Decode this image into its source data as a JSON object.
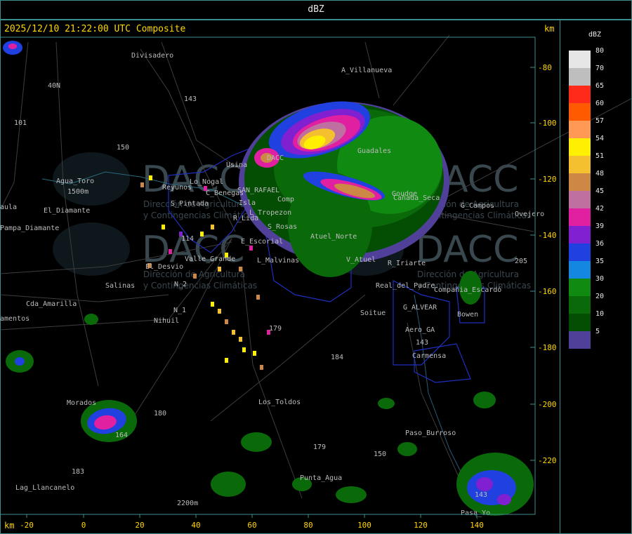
{
  "header": {
    "title": "dBZ"
  },
  "map": {
    "timestamp": "2025/12/10 21:22:00 UTC Composite",
    "km_label_top": "km",
    "km_label_bottom": "km",
    "x_ticks": [
      "-20",
      "0",
      "20",
      "40",
      "60",
      "80",
      "100",
      "120",
      "140"
    ],
    "y_ticks": [
      "-80",
      "-100",
      "-120",
      "-140",
      "-160",
      "-180",
      "-200",
      "-220"
    ],
    "places": [
      "Divisadero",
      "A_Villanueva",
      "40N",
      "143",
      "101",
      "150",
      "Usina",
      "Guadales",
      "DACC",
      "Agua_Toro",
      "1500m",
      "El_Diamante",
      "aula",
      "Reyunos",
      "Lo_Nogal",
      "C_Benegas",
      "SAN_RAFAEL",
      "Goudge",
      "Cañada_Seca",
      "G_Campos",
      "Ovejero",
      "Pampa_Diamante",
      "S_Pintada",
      "R_Lida",
      "L_Tropezon",
      "Isla",
      "Comp",
      "S_Rosas",
      "Atuel_Norte",
      "114",
      "E_Escorial",
      "205",
      "Valle_Grande",
      "L_Malvinas",
      "V_Atuel",
      "R_Iriarte",
      "El_Desvio",
      "Salinas",
      "Real_del_Padre",
      "Compañia_Escardó",
      "N_2",
      "N_1",
      "Cda_Amarilla",
      "amentos",
      "Nihuil",
      "Soitue",
      "G_ALVEAR",
      "Bowen",
      "179",
      "Aero_GA",
      "143",
      "Carmensa",
      "184",
      "Morados",
      "Los_Toldos",
      "180",
      "Paso_Burroso",
      "164",
      "179",
      "150",
      "183",
      "Punta_Agua",
      "Lag_Llancanelo",
      "2200m",
      "143",
      "Pasa_Yo"
    ],
    "watermark_logo": "DACC",
    "watermark_lines": [
      "Dirección de Agricultura",
      "y Contingencias Climáticas"
    ]
  },
  "legend": {
    "title": "dBZ",
    "items": [
      {
        "label": "80",
        "color": "#e6e6e6"
      },
      {
        "label": "70",
        "color": "#bebebe"
      },
      {
        "label": "65",
        "color": "#ff2a1a"
      },
      {
        "label": "60",
        "color": "#ff5a00"
      },
      {
        "label": "57",
        "color": "#ff9955"
      },
      {
        "label": "54",
        "color": "#ffef00"
      },
      {
        "label": "51",
        "color": "#f5c030"
      },
      {
        "label": "48",
        "color": "#cc8844"
      },
      {
        "label": "45",
        "color": "#c070a0"
      },
      {
        "label": "42",
        "color": "#e020a0"
      },
      {
        "label": "39",
        "color": "#8020d0"
      },
      {
        "label": "36",
        "color": "#2040e0"
      },
      {
        "label": "35",
        "color": "#1488e0"
      },
      {
        "label": "30",
        "color": "#108a10"
      },
      {
        "label": "20",
        "color": "#0a6a0a"
      },
      {
        "label": "10",
        "color": "#044e04"
      },
      {
        "label": "5",
        "color": "#50409a"
      }
    ]
  }
}
